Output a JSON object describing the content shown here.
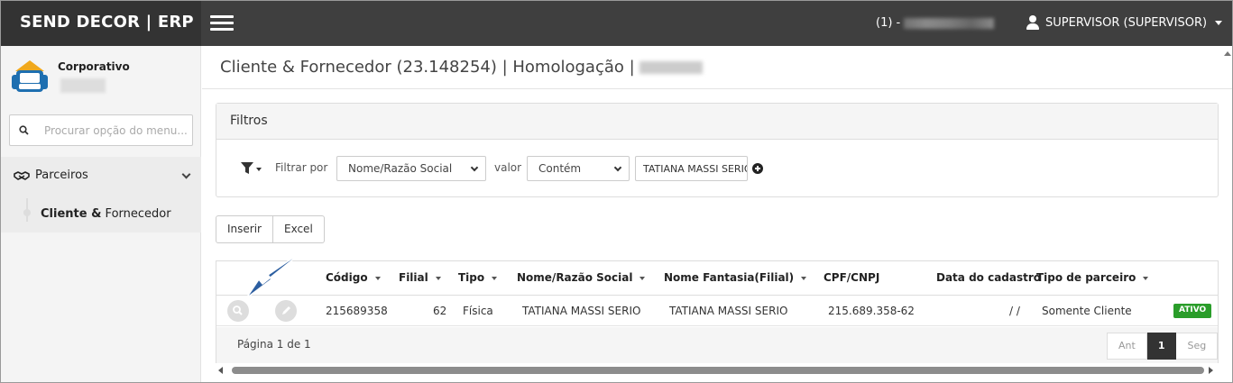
{
  "app": {
    "brand": "SEND DECOR | ERP"
  },
  "topbar": {
    "company_prefix": "(1) - ",
    "user_label": "SUPERVISOR (SUPERVISOR)"
  },
  "sidebar": {
    "org_title": "Corporativo",
    "search_placeholder": "Procurar opção do menu...",
    "group_label": "Parceiros",
    "child_label_bold": "Cliente &",
    "child_label_rest": " Fornecedor"
  },
  "page": {
    "title": "Cliente & Fornecedor (23.148254) | Homologação | "
  },
  "filters": {
    "heading": "Filtros",
    "filter_by_label": "Filtrar por",
    "field_select": "Nome/Razão Social",
    "value_label": "valor",
    "operator_select": "Contém",
    "value_input": "TATIANA MASSI SERIO"
  },
  "toolbar": {
    "insert_label": "Inserir",
    "excel_label": "Excel"
  },
  "grid": {
    "columns": [
      "Código",
      "Filial",
      "Tipo",
      "Nome/Razão Social",
      "Nome Fantasia(Filial)",
      "CPF/CNPJ",
      "Data do cadastro",
      "Tipo de parceiro"
    ],
    "rows": [
      {
        "codigo": "215689358",
        "filial": "62",
        "tipo": "Física",
        "nome": "TATIANA MASSI SERIO",
        "fantasia": "TATIANA MASSI SERIO",
        "cpf": "215.689.358-62",
        "data": "/ /",
        "parceiro": "Somente Cliente",
        "status": "ATIVO"
      }
    ],
    "page_info": "Página 1 de 1",
    "pager": {
      "prev": "Ant",
      "current": "1",
      "next": "Seg"
    }
  },
  "colors": {
    "topbar": "#3f3f3f",
    "brand_bg": "#333333",
    "active_badge": "#2a9d2a",
    "annotation_arrow": "#1f4f8f"
  }
}
